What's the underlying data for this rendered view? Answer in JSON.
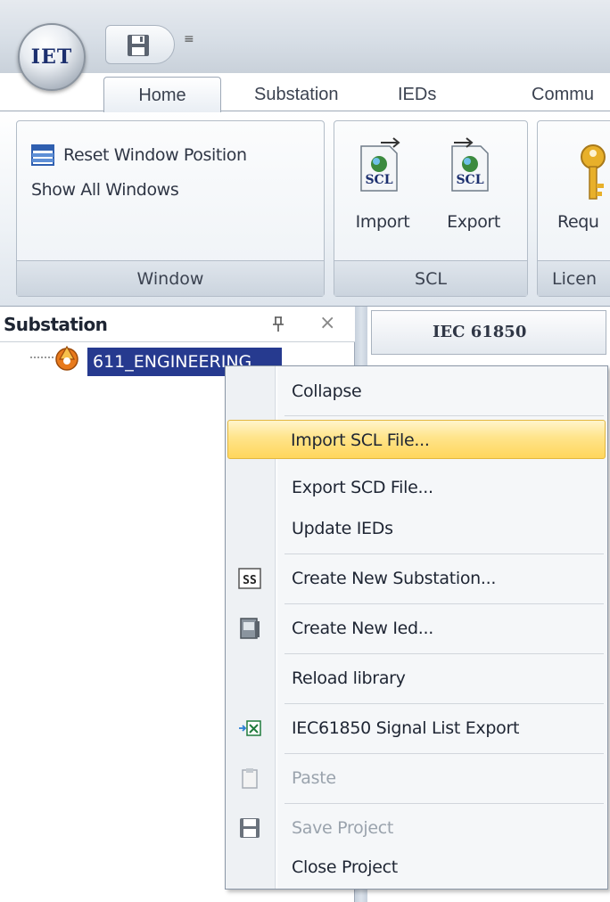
{
  "app": {
    "logo_text": "IET",
    "qat_dropdown_glyph": "≡"
  },
  "tabs": [
    {
      "label": "Home",
      "active": true
    },
    {
      "label": "Substation"
    },
    {
      "label": "IEDs"
    },
    {
      "label": "Commu"
    }
  ],
  "ribbon": {
    "window_group": {
      "label": "Window",
      "reset_label": "Reset Window Position",
      "show_all_label": "Show All Windows"
    },
    "scl_group": {
      "label": "SCL",
      "import_label": "Import",
      "export_label": "Export",
      "icon_text": "SCL"
    },
    "license_group": {
      "label": "Licen",
      "request_label": "Requ"
    }
  },
  "substation_pane": {
    "title": "Substation",
    "pin_glyph": "1",
    "close_glyph": "×",
    "tree": [
      {
        "label": "611_ENGINEERING",
        "icon": "substation-icon",
        "selected": true
      }
    ]
  },
  "document": {
    "tab_label": "IEC 61850"
  },
  "context_menu": {
    "items": [
      {
        "label": "Collapse"
      },
      {
        "label": "Import SCL File...",
        "highlighted": true
      },
      {
        "label": "Export SCD File..."
      },
      {
        "label": "Update IEDs"
      },
      {
        "label": "Create New Substation...",
        "icon": "substation-ss-icon",
        "icon_text": "SS"
      },
      {
        "label": "Create New Ied...",
        "icon": "ied-icon"
      },
      {
        "label": "Reload library"
      },
      {
        "label": "IEC61850 Signal List Export",
        "icon": "excel-export-icon"
      },
      {
        "label": "Paste",
        "icon": "clipboard-icon",
        "disabled": true
      },
      {
        "label": "Save Project",
        "icon": "floppy-disk-icon",
        "disabled": true
      },
      {
        "label": "Close Project"
      }
    ]
  },
  "colors": {
    "selection_bg": "#263a8f",
    "menu_highlight": "#ffd65c",
    "ribbon_border": "#9ea9b7"
  }
}
